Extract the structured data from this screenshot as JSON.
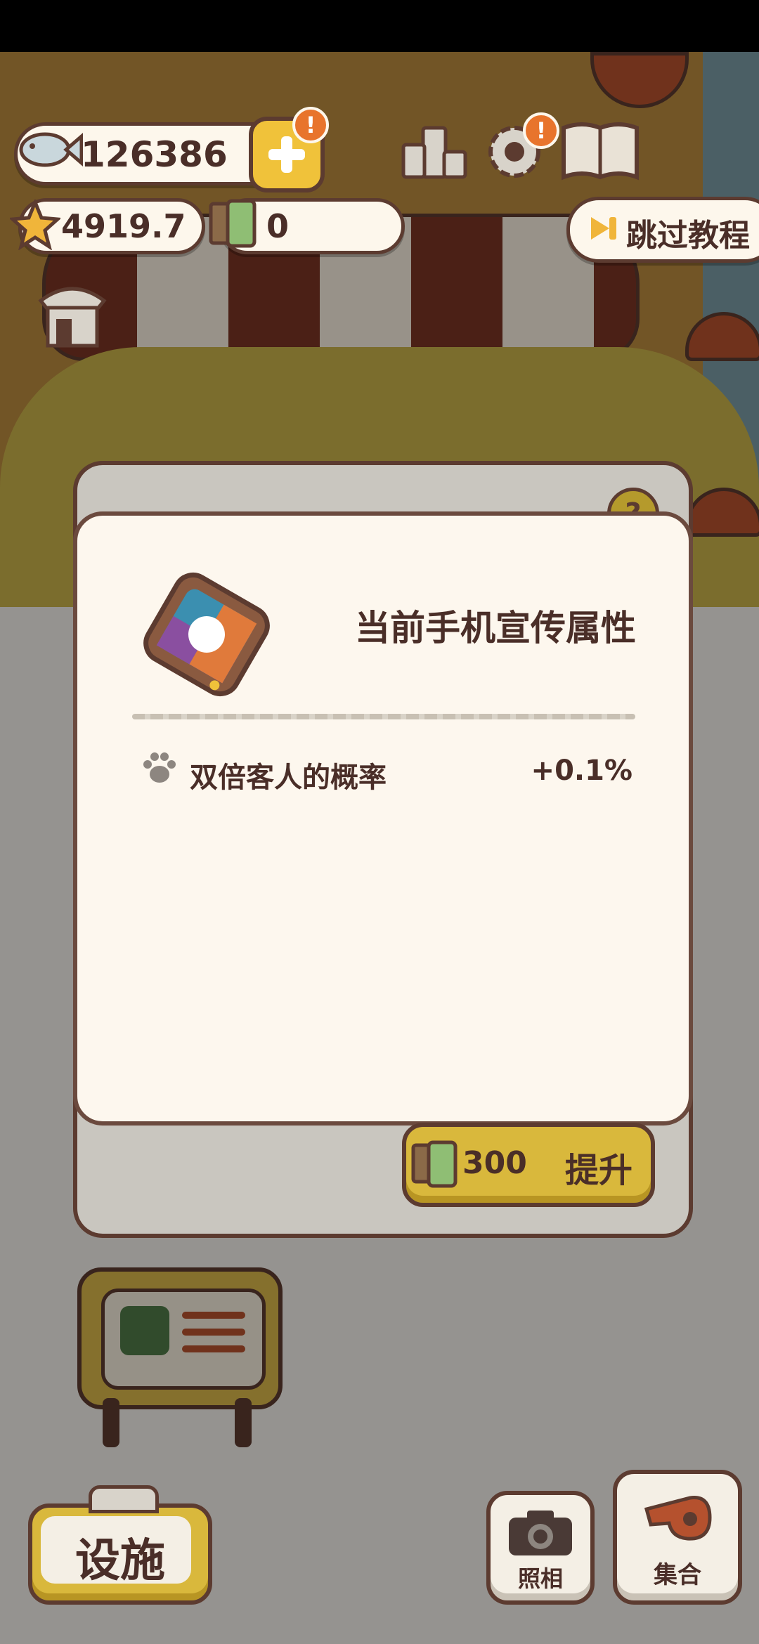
{
  "hud": {
    "fish_count": "126386",
    "star_count": "4919.7",
    "film_count": "0",
    "alert_mark": "!",
    "skip_tutorial_label": "跳过教程"
  },
  "panel": {
    "help_mark": "?",
    "title": "当前手机宣传属性",
    "attribute_label": "双倍客人的概率",
    "attribute_value": "+0.1%",
    "upgrade_cost": "300",
    "upgrade_label": "提升"
  },
  "bottom": {
    "facilities_label": "设施",
    "camera_label": "照相",
    "gather_label": "集合"
  },
  "colors": {
    "brown_outline": "#5c3b30",
    "cream": "#fdf7ee",
    "gold": "#d9b83c",
    "orange_alert": "#e8742c"
  },
  "icons": [
    "fish-icon",
    "plus-icon",
    "ranking-icon",
    "gear-icon",
    "book-icon",
    "star-icon",
    "film-icon",
    "skip-icon",
    "shop-icon",
    "phone-icon",
    "paw-icon",
    "tv-icon",
    "camera-icon",
    "whistle-icon"
  ]
}
